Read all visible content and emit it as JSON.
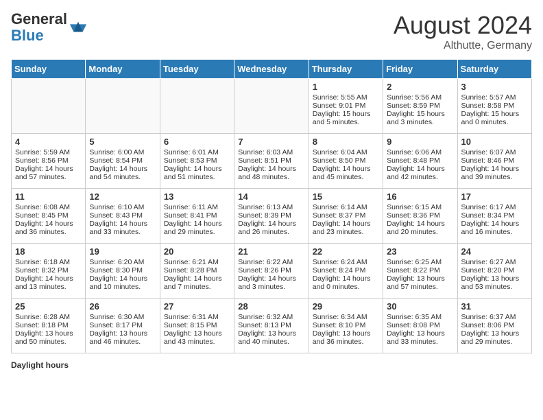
{
  "header": {
    "logo_general": "General",
    "logo_blue": "Blue",
    "month_title": "August 2024",
    "location": "Althutte, Germany"
  },
  "footer": {
    "label": "Daylight hours"
  },
  "days_of_week": [
    "Sunday",
    "Monday",
    "Tuesday",
    "Wednesday",
    "Thursday",
    "Friday",
    "Saturday"
  ],
  "weeks": [
    [
      {
        "day": "",
        "info": ""
      },
      {
        "day": "",
        "info": ""
      },
      {
        "day": "",
        "info": ""
      },
      {
        "day": "",
        "info": ""
      },
      {
        "day": "1",
        "info": "Sunrise: 5:55 AM\nSunset: 9:01 PM\nDaylight: 15 hours\nand 5 minutes."
      },
      {
        "day": "2",
        "info": "Sunrise: 5:56 AM\nSunset: 8:59 PM\nDaylight: 15 hours\nand 3 minutes."
      },
      {
        "day": "3",
        "info": "Sunrise: 5:57 AM\nSunset: 8:58 PM\nDaylight: 15 hours\nand 0 minutes."
      }
    ],
    [
      {
        "day": "4",
        "info": "Sunrise: 5:59 AM\nSunset: 8:56 PM\nDaylight: 14 hours\nand 57 minutes."
      },
      {
        "day": "5",
        "info": "Sunrise: 6:00 AM\nSunset: 8:54 PM\nDaylight: 14 hours\nand 54 minutes."
      },
      {
        "day": "6",
        "info": "Sunrise: 6:01 AM\nSunset: 8:53 PM\nDaylight: 14 hours\nand 51 minutes."
      },
      {
        "day": "7",
        "info": "Sunrise: 6:03 AM\nSunset: 8:51 PM\nDaylight: 14 hours\nand 48 minutes."
      },
      {
        "day": "8",
        "info": "Sunrise: 6:04 AM\nSunset: 8:50 PM\nDaylight: 14 hours\nand 45 minutes."
      },
      {
        "day": "9",
        "info": "Sunrise: 6:06 AM\nSunset: 8:48 PM\nDaylight: 14 hours\nand 42 minutes."
      },
      {
        "day": "10",
        "info": "Sunrise: 6:07 AM\nSunset: 8:46 PM\nDaylight: 14 hours\nand 39 minutes."
      }
    ],
    [
      {
        "day": "11",
        "info": "Sunrise: 6:08 AM\nSunset: 8:45 PM\nDaylight: 14 hours\nand 36 minutes."
      },
      {
        "day": "12",
        "info": "Sunrise: 6:10 AM\nSunset: 8:43 PM\nDaylight: 14 hours\nand 33 minutes."
      },
      {
        "day": "13",
        "info": "Sunrise: 6:11 AM\nSunset: 8:41 PM\nDaylight: 14 hours\nand 29 minutes."
      },
      {
        "day": "14",
        "info": "Sunrise: 6:13 AM\nSunset: 8:39 PM\nDaylight: 14 hours\nand 26 minutes."
      },
      {
        "day": "15",
        "info": "Sunrise: 6:14 AM\nSunset: 8:37 PM\nDaylight: 14 hours\nand 23 minutes."
      },
      {
        "day": "16",
        "info": "Sunrise: 6:15 AM\nSunset: 8:36 PM\nDaylight: 14 hours\nand 20 minutes."
      },
      {
        "day": "17",
        "info": "Sunrise: 6:17 AM\nSunset: 8:34 PM\nDaylight: 14 hours\nand 16 minutes."
      }
    ],
    [
      {
        "day": "18",
        "info": "Sunrise: 6:18 AM\nSunset: 8:32 PM\nDaylight: 14 hours\nand 13 minutes."
      },
      {
        "day": "19",
        "info": "Sunrise: 6:20 AM\nSunset: 8:30 PM\nDaylight: 14 hours\nand 10 minutes."
      },
      {
        "day": "20",
        "info": "Sunrise: 6:21 AM\nSunset: 8:28 PM\nDaylight: 14 hours\nand 7 minutes."
      },
      {
        "day": "21",
        "info": "Sunrise: 6:22 AM\nSunset: 8:26 PM\nDaylight: 14 hours\nand 3 minutes."
      },
      {
        "day": "22",
        "info": "Sunrise: 6:24 AM\nSunset: 8:24 PM\nDaylight: 14 hours\nand 0 minutes."
      },
      {
        "day": "23",
        "info": "Sunrise: 6:25 AM\nSunset: 8:22 PM\nDaylight: 13 hours\nand 57 minutes."
      },
      {
        "day": "24",
        "info": "Sunrise: 6:27 AM\nSunset: 8:20 PM\nDaylight: 13 hours\nand 53 minutes."
      }
    ],
    [
      {
        "day": "25",
        "info": "Sunrise: 6:28 AM\nSunset: 8:18 PM\nDaylight: 13 hours\nand 50 minutes."
      },
      {
        "day": "26",
        "info": "Sunrise: 6:30 AM\nSunset: 8:17 PM\nDaylight: 13 hours\nand 46 minutes."
      },
      {
        "day": "27",
        "info": "Sunrise: 6:31 AM\nSunset: 8:15 PM\nDaylight: 13 hours\nand 43 minutes."
      },
      {
        "day": "28",
        "info": "Sunrise: 6:32 AM\nSunset: 8:13 PM\nDaylight: 13 hours\nand 40 minutes."
      },
      {
        "day": "29",
        "info": "Sunrise: 6:34 AM\nSunset: 8:10 PM\nDaylight: 13 hours\nand 36 minutes."
      },
      {
        "day": "30",
        "info": "Sunrise: 6:35 AM\nSunset: 8:08 PM\nDaylight: 13 hours\nand 33 minutes."
      },
      {
        "day": "31",
        "info": "Sunrise: 6:37 AM\nSunset: 8:06 PM\nDaylight: 13 hours\nand 29 minutes."
      }
    ]
  ]
}
